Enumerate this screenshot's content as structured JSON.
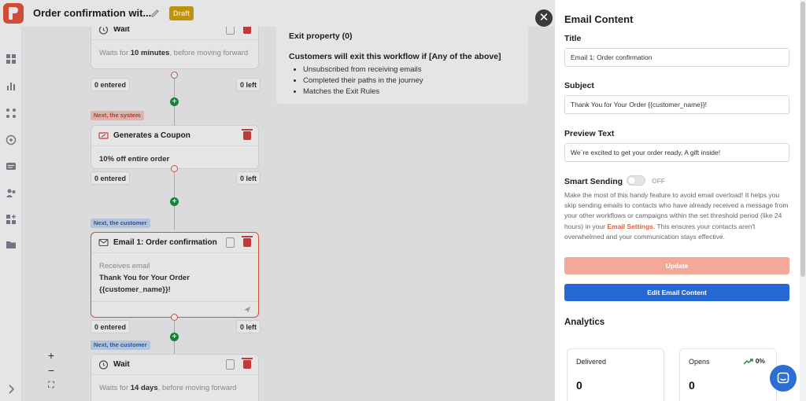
{
  "header": {
    "workflow_title": "Order confirmation wit...",
    "status_badge": "Draft"
  },
  "colors": {
    "brand": "#e8553d",
    "draft": "#d4a30c",
    "update_button": "#f3a998",
    "primary_button": "#2568d6",
    "link": "#e0603f"
  },
  "sidebar": {
    "icons": [
      "dashboard-icon",
      "analytics-icon",
      "apps-icon",
      "compass-icon",
      "message-icon",
      "contacts-icon",
      "integrations-icon",
      "folder-icon",
      "expand-icon"
    ]
  },
  "workflow": {
    "node_wait_top": {
      "title": "Wait",
      "desc_prefix": "Waits for",
      "desc_value": "10 minutes",
      "desc_suffix": ", before moving forward",
      "entered": "0 entered",
      "left": "0 left"
    },
    "tag_system": "Next, the system",
    "node_coupon": {
      "title": "Generates a Coupon",
      "desc": "10% off entire order",
      "entered": "0 entered",
      "left": "0 left"
    },
    "tag_customer_1": "Next, the customer",
    "node_email": {
      "title": "Email 1: Order confirmation",
      "receives": "Receives email",
      "subject_line1": "Thank You for Your Order",
      "subject_line2": "{{customer_name}}!",
      "entered": "0 entered",
      "left": "0 left"
    },
    "tag_customer_2": "Next, the customer",
    "node_wait_bottom": {
      "title": "Wait",
      "desc_prefix": "Waits for",
      "desc_value": "14 days",
      "desc_suffix": ", before moving forward"
    }
  },
  "exit_panel": {
    "property": "Exit property  (0)",
    "condition": "Customers will exit this workflow if [Any of the above]",
    "rules": [
      "Unsubscribed from receiving emails",
      "Completed their paths in the journey",
      "Matches the Exit Rules"
    ]
  },
  "zoom": {
    "in": "+",
    "out": "−",
    "fit": "⛶"
  },
  "drawer": {
    "heading": "Email Content",
    "title_label": "Title",
    "title_value": "Email 1: Order confirmation",
    "subject_label": "Subject",
    "subject_value": "Thank You for Your Order {{customer_name}}!",
    "preview_label": "Preview Text",
    "preview_value": "We`re excited to get your order ready, A gift inside!",
    "smart_label": "Smart Sending",
    "smart_state": "OFF",
    "smart_desc_1": "Make the most of this handy feature to avoid email overload! It helps you skip sending emails to contacts who have already received a message from your other workflows or campaigns within the set threshold period (like 24 hours) in your ",
    "smart_link": "Email Settings",
    "smart_desc_2": ". This ensures your contacts aren't overwhelmed and your communication stays effective.",
    "update_button": "Update",
    "edit_button": "Edit Email Content",
    "analytics_heading": "Analytics",
    "stats": [
      {
        "label": "Delivered",
        "value": "0"
      },
      {
        "label": "Opens",
        "value": "0",
        "trend": "0%"
      }
    ]
  }
}
